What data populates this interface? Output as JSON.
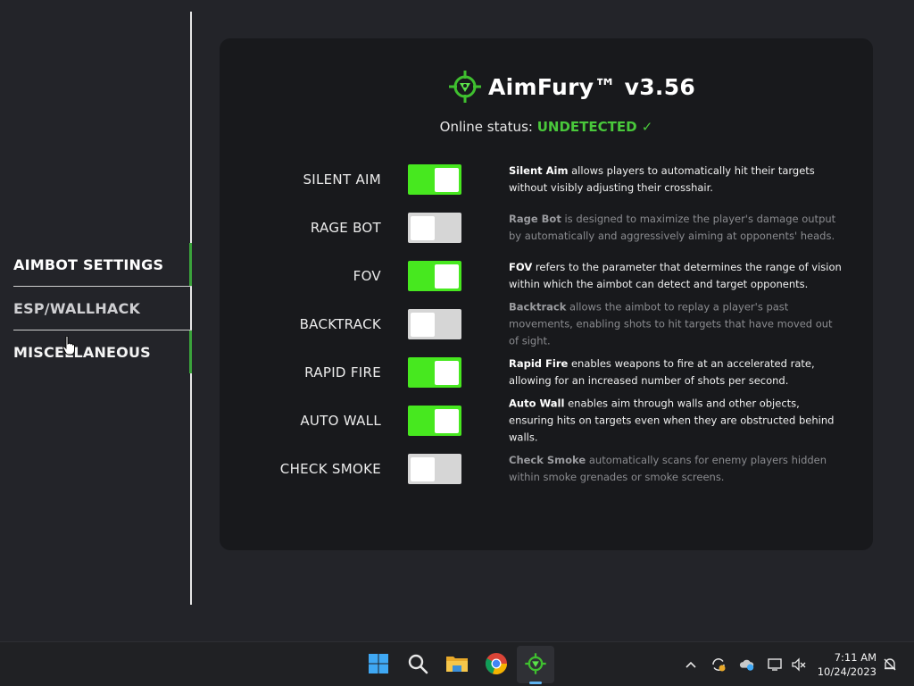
{
  "app": {
    "title": "AimFury™ v3.56",
    "status_label": "Online status:",
    "status_value": "UNDETECTED ✓"
  },
  "nav": {
    "items": [
      {
        "label": "AIMBOT SETTINGS"
      },
      {
        "label": "ESP/WALLHACK"
      },
      {
        "label": "MISCELLANEOUS"
      }
    ]
  },
  "settings": [
    {
      "label": "SILENT AIM",
      "enabled": true,
      "name": "Silent Aim",
      "text": " allows players to automatically hit their targets without visibly adjusting their crosshair."
    },
    {
      "label": "RAGE BOT",
      "enabled": false,
      "name": "Rage Bot",
      "text": " is designed to maximize the player's damage output by automatically and aggressively aiming at opponents' heads."
    },
    {
      "label": "FOV",
      "enabled": true,
      "name": "FOV",
      "text": " refers to the parameter that determines the range of vision within which the aimbot can detect and target opponents."
    },
    {
      "label": "BACKTRACK",
      "enabled": false,
      "name": "Backtrack",
      "text": " allows the aimbot to replay a player's past movements, enabling shots to hit targets that have moved out of sight."
    },
    {
      "label": "RAPID FIRE",
      "enabled": true,
      "name": "Rapid Fire",
      "text": " enables weapons to fire at an accelerated rate, allowing for an increased number of shots per second."
    },
    {
      "label": "AUTO WALL",
      "enabled": true,
      "name": "Auto Wall",
      "text": " enables aim through walls and other objects, ensuring hits on targets even when they are obstructed behind walls."
    },
    {
      "label": "CHECK SMOKE",
      "enabled": false,
      "name": "Check Smoke",
      "text": " automatically scans for enemy players hidden within smoke grenades or smoke screens."
    }
  ],
  "taskbar": {
    "clock_time": "7:11 AM",
    "clock_date": "10/24/2023",
    "apps": [
      "start-icon",
      "search-icon",
      "file-explorer-icon",
      "chrome-icon",
      "aimfury-icon"
    ]
  },
  "colors": {
    "accent_green": "#47e81f",
    "status_green": "#49c83b",
    "panel_bg": "#18191c",
    "app_bg": "#232429"
  }
}
